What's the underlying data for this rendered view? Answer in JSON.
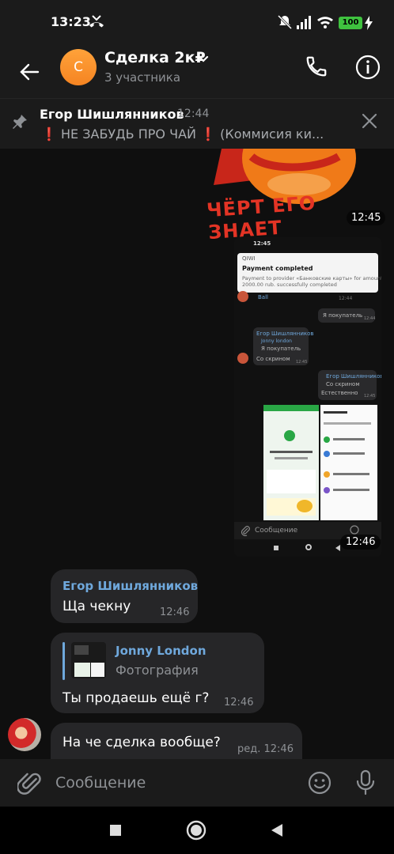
{
  "status_bar": {
    "time": "13:23",
    "battery": "100"
  },
  "header": {
    "title": "Сделка 2к₽",
    "subtitle": "3 участника"
  },
  "pinned": {
    "author": "Егор Шишлянников",
    "time": "12:44",
    "emoji": "❗",
    "text_main": "НЕ ЗАБУДЬ ПРО ЧАЙ",
    "text_rest": "(Коммисия ки..."
  },
  "sticker": {
    "caption": "ЧЁРТ ЕГО ЗНАЕТ",
    "time": "12:45"
  },
  "screenshot_message": {
    "time": "12:46",
    "inner": {
      "status_time": "12:45",
      "notif_app": "QIWI",
      "notif_title": "Payment completed",
      "notif_body_1": "Payment to provider «Банковские карты» for amount",
      "notif_body_2": "2000.00 rub. successfully completed",
      "ball": "Ball",
      "notif_time": "12:44",
      "own1": "Я покупатель",
      "own1_time": "12:44",
      "q_author": "Егор Шишлянников",
      "q_reply_name": "Jonny london",
      "q_reply_text": "Я покупатель",
      "q_text": "Со скрином",
      "q_time": "12:45",
      "own2_author": "Егор Шишлянников",
      "own2_reply": "Со скрином",
      "own2_text": "Естественно",
      "own2_time": "12:45",
      "composer_placeholder": "Сообщение"
    }
  },
  "messages": [
    {
      "author": "Егор Шишлянников",
      "text": "Ща чекну",
      "time": "12:46"
    },
    {
      "reply_name": "Jonny London",
      "reply_sub": "Фотография",
      "text": "Ты продаешь ещё г?",
      "time": "12:46"
    },
    {
      "text": "На че сделка вообще?",
      "time": "ред. 12:46"
    }
  ],
  "composer": {
    "placeholder": "Сообщение"
  },
  "colors": {
    "accent": "#6fa8dc",
    "bubble": "#262628",
    "background": "#0f0f0f",
    "avatar": "#f58422",
    "pin_emoji": "#e0302a"
  },
  "icons": [
    "back-arrow-icon",
    "chevron-down-icon",
    "phone-icon",
    "info-icon",
    "pin-icon",
    "close-icon",
    "paperclip-icon",
    "smile-icon",
    "microphone-icon",
    "stop-icon",
    "home-icon",
    "back-triangle-icon"
  ]
}
